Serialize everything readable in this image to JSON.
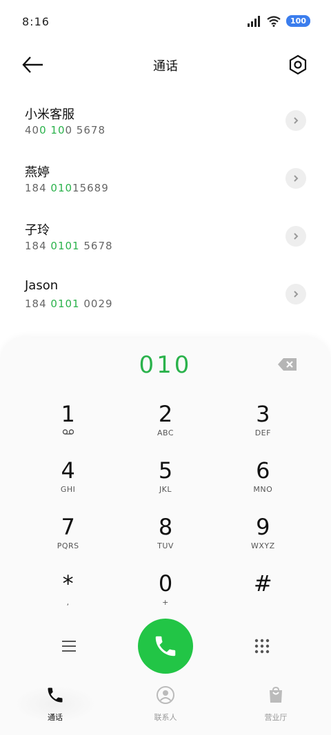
{
  "status_bar": {
    "time": "8:16",
    "battery": "100",
    "icons": [
      "signal-icon",
      "wifi-icon",
      "battery-icon"
    ]
  },
  "header": {
    "title": "通话",
    "back_icon": "back-arrow-icon",
    "settings_icon": "settings-icon"
  },
  "suggestions": [
    {
      "name": "小米客服",
      "number_parts": [
        "40",
        "0 10",
        "0 5678"
      ]
    },
    {
      "name": "燕婷",
      "number_parts": [
        "184 ",
        "010",
        "15689"
      ]
    },
    {
      "name": "子玲",
      "number_parts": [
        "184 ",
        "0101",
        " 5678"
      ]
    },
    {
      "name": "Jason",
      "number_parts": [
        "184 ",
        "0101",
        " 0029"
      ]
    }
  ],
  "dialer": {
    "typed_number": "010",
    "keys": [
      {
        "digit": "1",
        "sub": "voicemail-icon"
      },
      {
        "digit": "2",
        "sub": "ABC"
      },
      {
        "digit": "3",
        "sub": "DEF"
      },
      {
        "digit": "4",
        "sub": "GHI"
      },
      {
        "digit": "5",
        "sub": "JKL"
      },
      {
        "digit": "6",
        "sub": "MNO"
      },
      {
        "digit": "7",
        "sub": "PQRS"
      },
      {
        "digit": "8",
        "sub": "TUV"
      },
      {
        "digit": "9",
        "sub": "WXYZ"
      },
      {
        "digit": "*",
        "sub": ","
      },
      {
        "digit": "0",
        "sub": "+"
      },
      {
        "digit": "#",
        "sub": ""
      }
    ]
  },
  "bottom_nav": {
    "items": [
      {
        "label": "通话",
        "icon": "phone-icon",
        "active": true
      },
      {
        "label": "联系人",
        "icon": "contact-icon",
        "active": false
      },
      {
        "label": "营业厅",
        "icon": "store-bag-icon",
        "active": false
      }
    ]
  },
  "colors": {
    "accent_green": "#22c546",
    "highlight_green": "#2ab24b",
    "battery_blue": "#3b7ded"
  }
}
